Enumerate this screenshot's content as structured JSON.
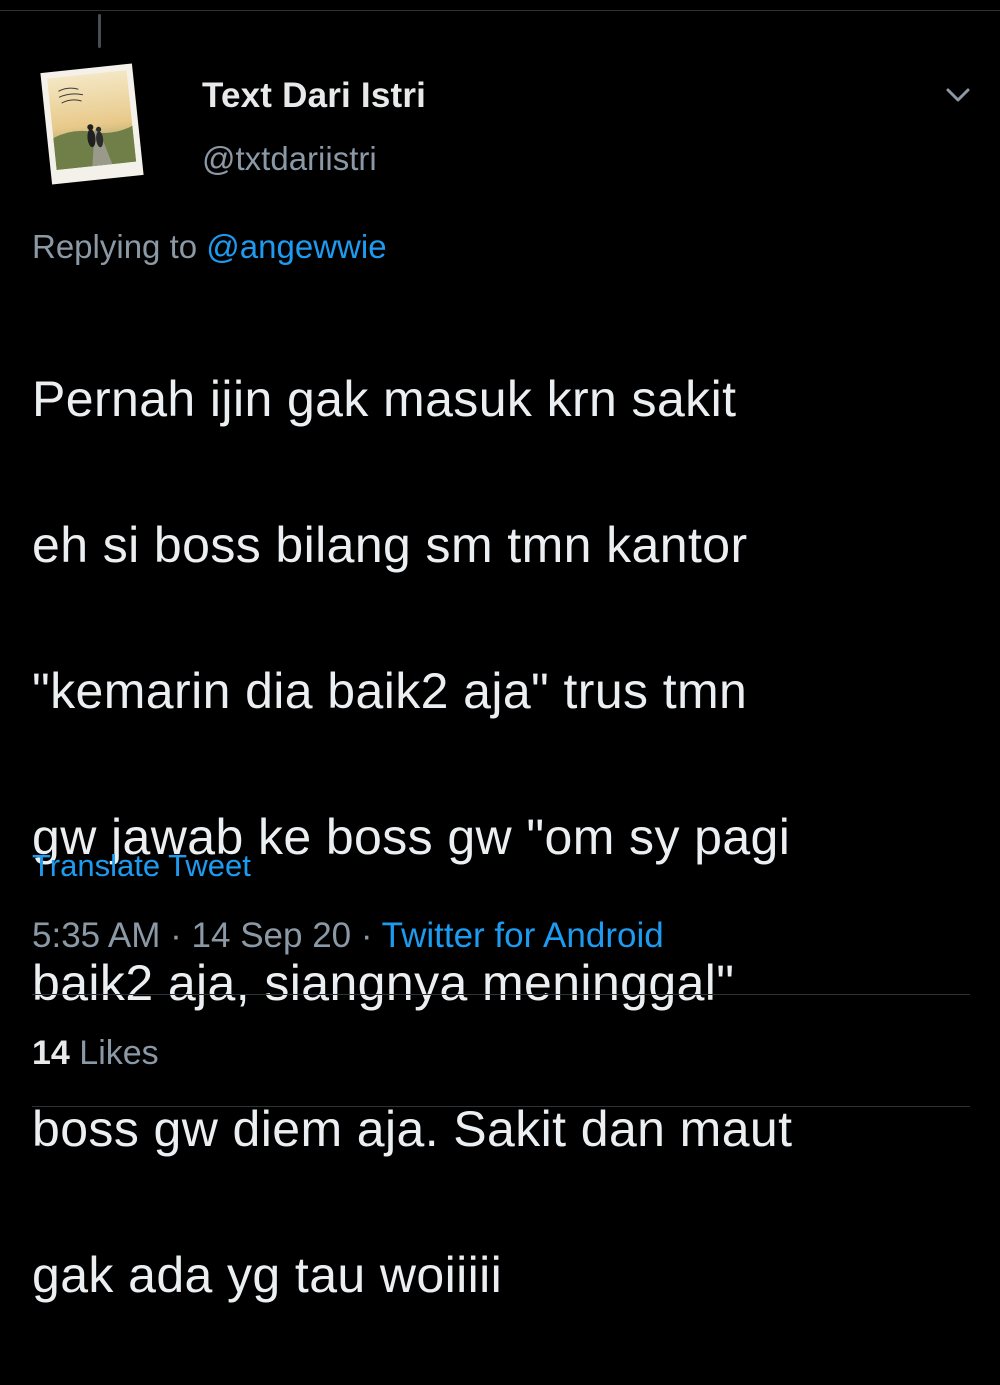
{
  "author": {
    "name": "Text Dari Istri",
    "handle": "@txtdariistri",
    "avatar_icon": "polaroid-avatar"
  },
  "reply": {
    "prefix": "Replying to",
    "mention": "@angewwie"
  },
  "tweet": {
    "lines": [
      "Pernah ijin gak masuk krn sakit",
      "eh si boss bilang sm tmn kantor",
      "\"kemarin dia baik2 aja\" trus tmn",
      "gw jawab ke boss gw \"om sy pagi",
      "baik2 aja, siangnya meninggal\"",
      "boss gw diem aja. Sakit dan maut",
      "gak ada yg tau woiiiii"
    ]
  },
  "translate_label": "Translate Tweet",
  "meta": {
    "time": "5:35 AM",
    "separator": "·",
    "date": "14 Sep 20",
    "source": "Twitter for Android"
  },
  "stats": {
    "likes_count": "14",
    "likes_label": "Likes"
  },
  "colors": {
    "background": "#000000",
    "text": "#e7e9ea",
    "muted": "#8b98a5",
    "accent": "#1d9bf0",
    "divider": "#2f3336"
  },
  "icons": {
    "more": "chevron-down-icon"
  }
}
